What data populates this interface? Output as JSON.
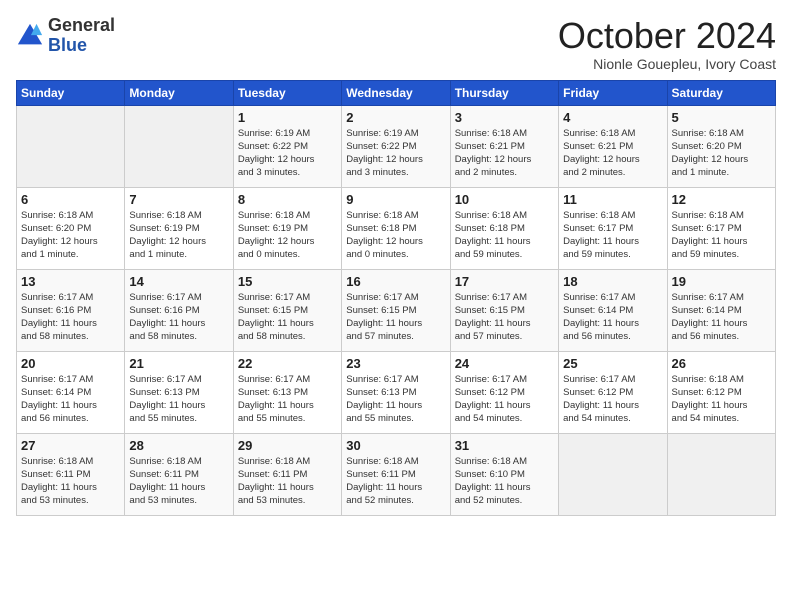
{
  "logo": {
    "general": "General",
    "blue": "Blue"
  },
  "title": "October 2024",
  "subtitle": "Nionle Gouepleu, Ivory Coast",
  "days_header": [
    "Sunday",
    "Monday",
    "Tuesday",
    "Wednesday",
    "Thursday",
    "Friday",
    "Saturday"
  ],
  "weeks": [
    [
      {
        "day": "",
        "info": ""
      },
      {
        "day": "",
        "info": ""
      },
      {
        "day": "1",
        "info": "Sunrise: 6:19 AM\nSunset: 6:22 PM\nDaylight: 12 hours\nand 3 minutes."
      },
      {
        "day": "2",
        "info": "Sunrise: 6:19 AM\nSunset: 6:22 PM\nDaylight: 12 hours\nand 3 minutes."
      },
      {
        "day": "3",
        "info": "Sunrise: 6:18 AM\nSunset: 6:21 PM\nDaylight: 12 hours\nand 2 minutes."
      },
      {
        "day": "4",
        "info": "Sunrise: 6:18 AM\nSunset: 6:21 PM\nDaylight: 12 hours\nand 2 minutes."
      },
      {
        "day": "5",
        "info": "Sunrise: 6:18 AM\nSunset: 6:20 PM\nDaylight: 12 hours\nand 1 minute."
      }
    ],
    [
      {
        "day": "6",
        "info": "Sunrise: 6:18 AM\nSunset: 6:20 PM\nDaylight: 12 hours\nand 1 minute."
      },
      {
        "day": "7",
        "info": "Sunrise: 6:18 AM\nSunset: 6:19 PM\nDaylight: 12 hours\nand 1 minute."
      },
      {
        "day": "8",
        "info": "Sunrise: 6:18 AM\nSunset: 6:19 PM\nDaylight: 12 hours\nand 0 minutes."
      },
      {
        "day": "9",
        "info": "Sunrise: 6:18 AM\nSunset: 6:18 PM\nDaylight: 12 hours\nand 0 minutes."
      },
      {
        "day": "10",
        "info": "Sunrise: 6:18 AM\nSunset: 6:18 PM\nDaylight: 11 hours\nand 59 minutes."
      },
      {
        "day": "11",
        "info": "Sunrise: 6:18 AM\nSunset: 6:17 PM\nDaylight: 11 hours\nand 59 minutes."
      },
      {
        "day": "12",
        "info": "Sunrise: 6:18 AM\nSunset: 6:17 PM\nDaylight: 11 hours\nand 59 minutes."
      }
    ],
    [
      {
        "day": "13",
        "info": "Sunrise: 6:17 AM\nSunset: 6:16 PM\nDaylight: 11 hours\nand 58 minutes."
      },
      {
        "day": "14",
        "info": "Sunrise: 6:17 AM\nSunset: 6:16 PM\nDaylight: 11 hours\nand 58 minutes."
      },
      {
        "day": "15",
        "info": "Sunrise: 6:17 AM\nSunset: 6:15 PM\nDaylight: 11 hours\nand 58 minutes."
      },
      {
        "day": "16",
        "info": "Sunrise: 6:17 AM\nSunset: 6:15 PM\nDaylight: 11 hours\nand 57 minutes."
      },
      {
        "day": "17",
        "info": "Sunrise: 6:17 AM\nSunset: 6:15 PM\nDaylight: 11 hours\nand 57 minutes."
      },
      {
        "day": "18",
        "info": "Sunrise: 6:17 AM\nSunset: 6:14 PM\nDaylight: 11 hours\nand 56 minutes."
      },
      {
        "day": "19",
        "info": "Sunrise: 6:17 AM\nSunset: 6:14 PM\nDaylight: 11 hours\nand 56 minutes."
      }
    ],
    [
      {
        "day": "20",
        "info": "Sunrise: 6:17 AM\nSunset: 6:14 PM\nDaylight: 11 hours\nand 56 minutes."
      },
      {
        "day": "21",
        "info": "Sunrise: 6:17 AM\nSunset: 6:13 PM\nDaylight: 11 hours\nand 55 minutes."
      },
      {
        "day": "22",
        "info": "Sunrise: 6:17 AM\nSunset: 6:13 PM\nDaylight: 11 hours\nand 55 minutes."
      },
      {
        "day": "23",
        "info": "Sunrise: 6:17 AM\nSunset: 6:13 PM\nDaylight: 11 hours\nand 55 minutes."
      },
      {
        "day": "24",
        "info": "Sunrise: 6:17 AM\nSunset: 6:12 PM\nDaylight: 11 hours\nand 54 minutes."
      },
      {
        "day": "25",
        "info": "Sunrise: 6:17 AM\nSunset: 6:12 PM\nDaylight: 11 hours\nand 54 minutes."
      },
      {
        "day": "26",
        "info": "Sunrise: 6:18 AM\nSunset: 6:12 PM\nDaylight: 11 hours\nand 54 minutes."
      }
    ],
    [
      {
        "day": "27",
        "info": "Sunrise: 6:18 AM\nSunset: 6:11 PM\nDaylight: 11 hours\nand 53 minutes."
      },
      {
        "day": "28",
        "info": "Sunrise: 6:18 AM\nSunset: 6:11 PM\nDaylight: 11 hours\nand 53 minutes."
      },
      {
        "day": "29",
        "info": "Sunrise: 6:18 AM\nSunset: 6:11 PM\nDaylight: 11 hours\nand 53 minutes."
      },
      {
        "day": "30",
        "info": "Sunrise: 6:18 AM\nSunset: 6:11 PM\nDaylight: 11 hours\nand 52 minutes."
      },
      {
        "day": "31",
        "info": "Sunrise: 6:18 AM\nSunset: 6:10 PM\nDaylight: 11 hours\nand 52 minutes."
      },
      {
        "day": "",
        "info": ""
      },
      {
        "day": "",
        "info": ""
      }
    ]
  ]
}
